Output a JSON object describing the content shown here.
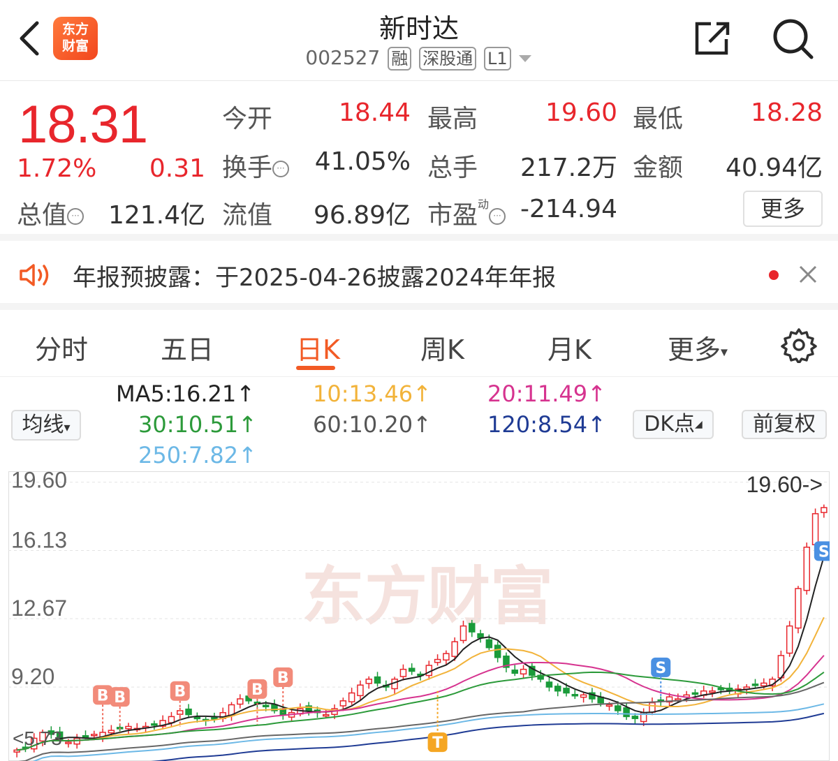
{
  "header": {
    "title": "新时达",
    "code": "002527",
    "tags": [
      "融",
      "深股通",
      "L1"
    ],
    "logo_line1": "东方",
    "logo_line2": "财富"
  },
  "quote": {
    "price": "18.31",
    "change_pct": "1.72%",
    "change": "0.31",
    "open_label": "今开",
    "open": "18.44",
    "high_label": "最高",
    "high": "19.60",
    "low_label": "最低",
    "low": "18.28",
    "turnover_label": "换手",
    "turnover": "41.05%",
    "volume_label": "总手",
    "volume": "217.2万",
    "amount_label": "金额",
    "amount": "40.94亿",
    "mcap_label": "总值",
    "mcap": "121.4亿",
    "float_label": "流值",
    "float": "96.89亿",
    "pe_label": "市盈",
    "pe_sup": "动",
    "pe": "-214.94",
    "more_label": "更多"
  },
  "notice": {
    "text": "年报预披露：于2025-04-26披露2024年年报"
  },
  "tabs": {
    "items": [
      "分时",
      "五日",
      "日K",
      "周K",
      "月K",
      "更多"
    ],
    "active": "日K"
  },
  "ma": {
    "selector_label": "均线",
    "ma5": "MA5:16.21↑",
    "ma10": "10:13.46↑",
    "ma20": "20:11.49↑",
    "ma30": "30:10.51↑",
    "ma60": "60:10.20↑",
    "ma120": "120:8.54↑",
    "ma250": "250:7.82↑",
    "dk_label": "DK点",
    "adjust_label": "前复权",
    "colors": {
      "ma5": "#222222",
      "ma10": "#f2b33a",
      "ma20": "#d6338f",
      "ma30": "#2c9a3a",
      "ma60": "#666666",
      "ma120": "#1f3b94",
      "ma250": "#6cb8e6"
    }
  },
  "chart_data": {
    "type": "candlestick",
    "y_ticks": [
      "19.60",
      "16.13",
      "12.67",
      "9.20"
    ],
    "ylim": [
      5.8,
      19.8
    ],
    "last_price_label": "19.60->",
    "min_label": "<5.73",
    "watermark": "东方财富",
    "signal_labels": {
      "buy": "B",
      "sell": "S",
      "t": "T"
    },
    "closes": [
      6.0,
      6.1,
      6.6,
      6.9,
      6.8,
      6.5,
      6.4,
      6.6,
      6.7,
      6.8,
      6.9,
      7.0,
      7.1,
      7.2,
      7.1,
      7.2,
      7.3,
      7.5,
      7.7,
      8.0,
      7.8,
      7.6,
      7.5,
      7.6,
      7.9,
      8.3,
      8.6,
      8.5,
      8.4,
      8.2,
      8.0,
      7.8,
      7.9,
      8.1,
      8.0,
      7.9,
      7.8,
      8.1,
      8.5,
      8.9,
      9.3,
      9.6,
      9.4,
      9.2,
      9.6,
      10.1,
      10.0,
      9.8,
      10.3,
      10.6,
      10.9,
      11.5,
      12.3,
      12.0,
      11.7,
      11.2,
      10.7,
      10.2,
      9.9,
      10.1,
      9.8,
      9.6,
      9.2,
      9.0,
      8.9,
      8.8,
      8.8,
      8.6,
      8.4,
      8.3,
      8.0,
      7.7,
      7.6,
      7.9,
      8.4,
      8.5,
      8.7,
      8.6,
      8.8,
      8.9,
      9.0,
      9.0,
      9.1,
      9.0,
      9.1,
      9.2,
      9.3,
      9.4,
      9.6,
      10.8,
      12.3,
      14.2,
      16.3,
      18.0,
      18.31
    ],
    "ma_series": [
      "ma5",
      "ma10",
      "ma20",
      "ma30",
      "ma60",
      "ma120",
      "ma250"
    ]
  }
}
